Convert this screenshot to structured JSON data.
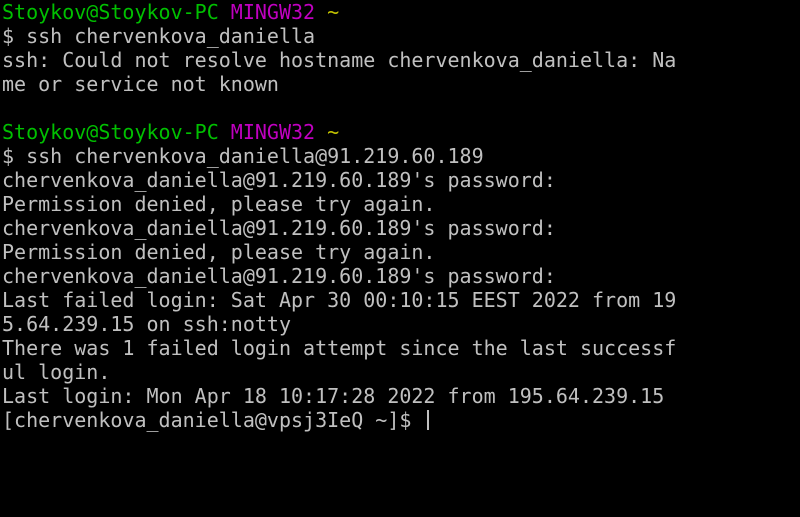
{
  "colors": {
    "background": "#000000",
    "text": "#c0c0c0",
    "user_host": "#00c000",
    "mingw": "#c000c0",
    "tilde": "#c0c000"
  },
  "session1": {
    "prompt_user": "Stoykov@Stoykov-PC",
    "prompt_env": "MINGW32",
    "prompt_dir": "~",
    "command": "$ ssh chervenkova_daniella",
    "error_line1": "ssh: Could not resolve hostname chervenkova_daniella: Na",
    "error_line2": "me or service not known"
  },
  "session2": {
    "prompt_user": "Stoykov@Stoykov-PC",
    "prompt_env": "MINGW32",
    "prompt_dir": "~",
    "command": "$ ssh chervenkova_daniella@91.219.60.189",
    "output": [
      "chervenkova_daniella@91.219.60.189's password:",
      "Permission denied, please try again.",
      "chervenkova_daniella@91.219.60.189's password:",
      "Permission denied, please try again.",
      "chervenkova_daniella@91.219.60.189's password:",
      "Last failed login: Sat Apr 30 00:10:15 EEST 2022 from 19",
      "5.64.239.15 on ssh:notty",
      "There was 1 failed login attempt since the last successf",
      "ul login.",
      "Last login: Mon Apr 18 10:17:28 2022 from 195.64.239.15"
    ],
    "remote_prompt": "[chervenkova_daniella@vpsj3IeQ ~]$ "
  }
}
